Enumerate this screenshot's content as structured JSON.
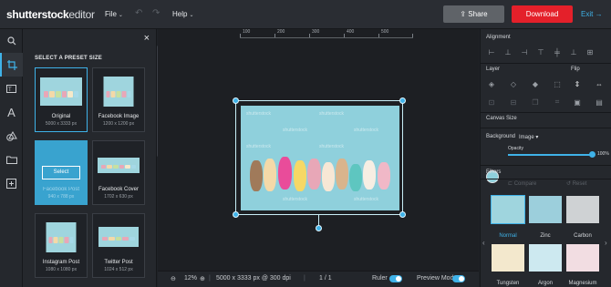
{
  "app": {
    "logo_bold": "shutterstock",
    "logo_light": "editor",
    "menus": [
      {
        "label": "File"
      },
      {
        "label": "Help"
      }
    ],
    "share_label": "Share",
    "download_label": "Download",
    "exit_label": "Exit",
    "colors": {
      "accent": "#3fb2e8",
      "download": "#e4202a",
      "panel": "#25282d"
    }
  },
  "rail": {
    "icons": [
      "search-icon",
      "crop-icon",
      "text-icon",
      "text-icon",
      "shapes-icon",
      "folder-icon",
      "add-image-icon"
    ]
  },
  "presets": {
    "title": "SELECT A PRESET SIZE",
    "close": "×",
    "select_label": "Select",
    "items": [
      {
        "name": "Original",
        "dims": "5000 x 3333 px"
      },
      {
        "name": "Facebook Image",
        "dims": "1200 x 1200 px"
      },
      {
        "name": "Facebook Post",
        "dims": "940 x 788 px"
      },
      {
        "name": "Facebook Cover",
        "dims": "1702 x 630 px"
      },
      {
        "name": "Instagram Post",
        "dims": "1080 x 1080 px"
      },
      {
        "name": "Twitter Post",
        "dims": "1024 x 512 px"
      }
    ]
  },
  "ruler": {
    "ticks": [
      "100",
      "200",
      "300",
      "400",
      "500"
    ]
  },
  "canvas": {
    "watermark": "shutterstock"
  },
  "status": {
    "zoom": "12%",
    "size": "5000 x 3333 px @ 300 dpi",
    "page": "1 / 1",
    "ruler_label": "Ruler",
    "preview_label": "Preview Mode"
  },
  "rpanel": {
    "alignment": "Alignment",
    "layer": "Layer",
    "flip": "Flip",
    "canvas_size": "Canvas Size",
    "background": "Background",
    "bg_type": "Image",
    "opacity_label": "Opacity",
    "opacity_value": "100%",
    "opacity_fraction": 1.0,
    "filters": "Filters",
    "compare": "Compare",
    "reset": "Reset",
    "filter_items": [
      {
        "name": "Normal"
      },
      {
        "name": "Zinc"
      },
      {
        "name": "Carbon"
      },
      {
        "name": "Tungsten"
      },
      {
        "name": "Argon"
      },
      {
        "name": "Magnesium"
      }
    ]
  }
}
